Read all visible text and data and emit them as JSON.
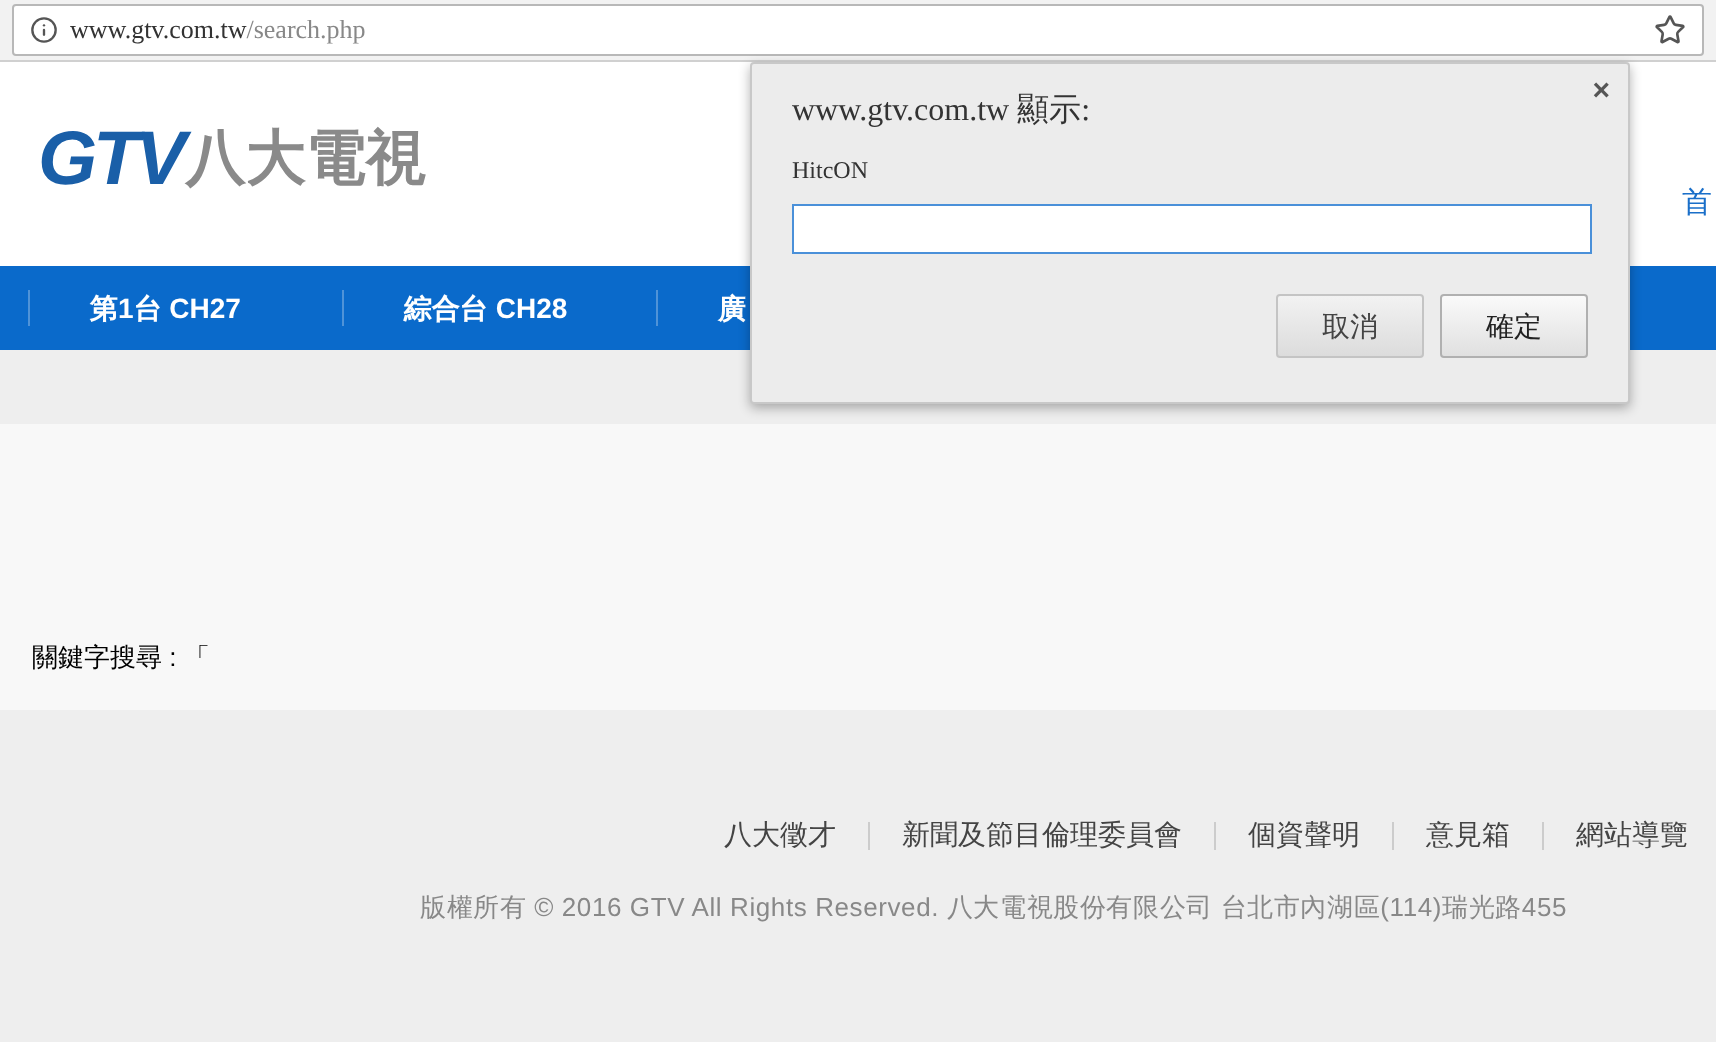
{
  "browser": {
    "url_host": "www.gtv.com.tw",
    "url_path": "/search.php"
  },
  "header": {
    "logo_mark": "GTV",
    "logo_name": "八大電視",
    "top_link": "首"
  },
  "nav": [
    {
      "label": "第1台 CH27"
    },
    {
      "label": "綜合台 CH28"
    },
    {
      "label": "廣"
    }
  ],
  "search_result": {
    "label": "關鍵字搜尋 : 「"
  },
  "footer": {
    "links": [
      "八大徵才",
      "新聞及節目倫理委員會",
      "個資聲明",
      "意見箱",
      "網站導覽"
    ],
    "copyright": "版權所有 © 2016 GTV All Rights Reserved. 八大電視股份有限公司 台北市內湖區(114)瑞光路455"
  },
  "dialog": {
    "title": "www.gtv.com.tw 顯示:",
    "message": "HitcON",
    "close": "×",
    "buttons": [
      {
        "label": "取消",
        "kind": "cancel"
      },
      {
        "label": "確定",
        "kind": "ok"
      }
    ]
  }
}
